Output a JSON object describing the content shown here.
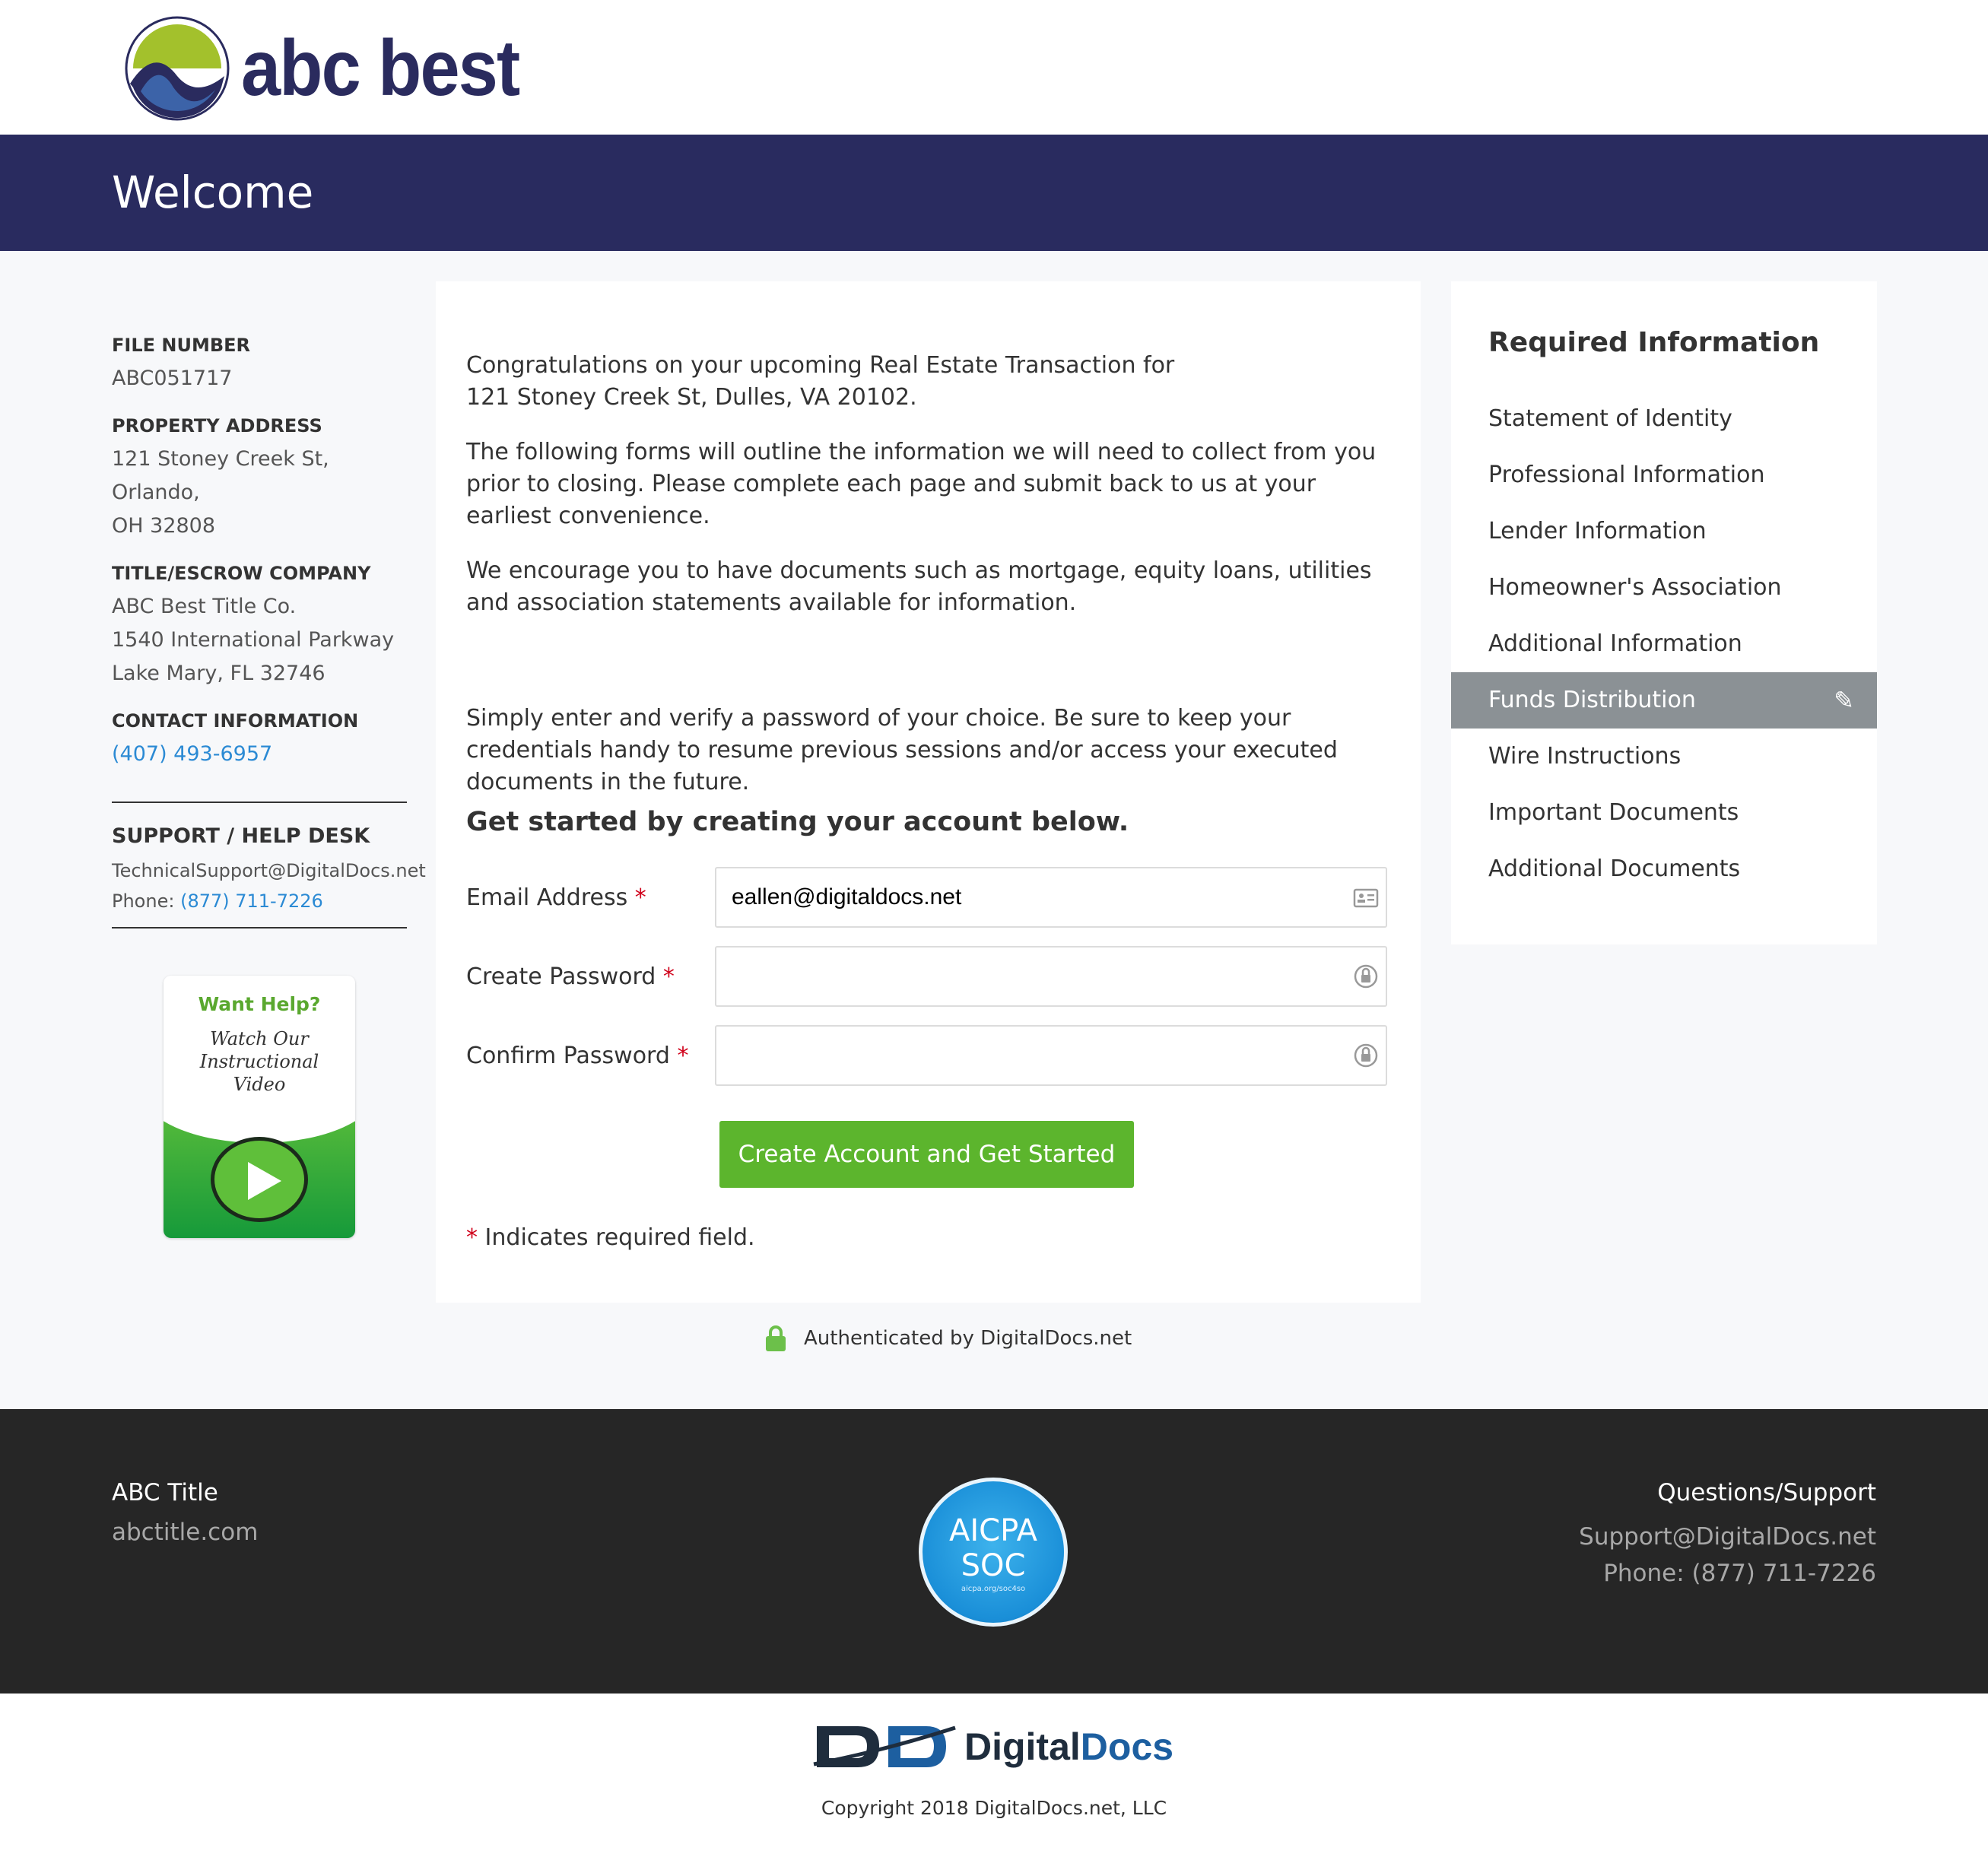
{
  "brand": {
    "logo_text": "abc best",
    "colors": {
      "navy": "#292b5f",
      "green": "#5cb52d",
      "link": "#2b8ad4"
    }
  },
  "header": {
    "title": "Welcome"
  },
  "left": {
    "file_number_label": "FILE NUMBER",
    "file_number": "ABC051717",
    "property_label": "PROPERTY ADDRESS",
    "property_line1": "121 Stoney Creek St, Orlando,",
    "property_line2": "OH 32808",
    "company_label": "TITLE/ESCROW COMPANY",
    "company_line1": "ABC Best Title Co.",
    "company_line2": "1540 International Parkway",
    "company_line3": "Lake Mary, FL 32746",
    "contact_label": "CONTACT INFORMATION",
    "contact_phone": "(407) 493-6957",
    "support_label": "SUPPORT / HELP DESK",
    "support_email": "TechnicalSupport@DigitalDocs.net",
    "support_phone_label": "Phone:",
    "support_phone": "(877) 711-7226",
    "help_title": "Want Help?",
    "help_line1": "Watch Our",
    "help_line2": "Instructional",
    "help_line3": "Video"
  },
  "main": {
    "intro_line1": "Congratulations on your upcoming Real Estate Transaction for",
    "intro_line2": "121 Stoney Creek St, Dulles, VA 20102.",
    "para2": "The following forms will outline the information we will need to collect from you prior to closing. Please complete each page and submit back to us at your earliest convenience.",
    "para3": "We encourage you to have documents such as mortgage, equity loans, utilities and association statements available for information.",
    "para4": "Simply enter and verify a password of your choice. Be sure to keep your credentials handy to resume previous sessions and/or access your executed documents in the future.",
    "heading": "Get started by creating your account below.",
    "email_label": "Email Address",
    "email_value": "eallen@digitaldocs.net",
    "password_label": "Create Password",
    "password_value": "",
    "confirm_label": "Confirm Password",
    "confirm_value": "",
    "required_mark": "*",
    "submit_label": "Create Account and Get Started",
    "required_note": "Indicates required field.",
    "auth_text": "Authenticated by DigitalDocs.net"
  },
  "right": {
    "title": "Required Information",
    "items": [
      {
        "label": "Statement of Identity",
        "active": false
      },
      {
        "label": "Professional Information",
        "active": false
      },
      {
        "label": "Lender Information",
        "active": false
      },
      {
        "label": "Homeowner's Association",
        "active": false
      },
      {
        "label": "Additional Information",
        "active": false
      },
      {
        "label": "Funds Distribution",
        "active": true,
        "icon": "pencil-icon"
      },
      {
        "label": "Wire Instructions",
        "active": false
      },
      {
        "label": "Important Documents",
        "active": false
      },
      {
        "label": "Additional Documents",
        "active": false
      }
    ]
  },
  "footer": {
    "left_title": "ABC Title",
    "left_link": "abctitle.com",
    "badge_line1": "AICPA",
    "badge_line2": "SOC",
    "badge_url": "aicpa.org/soc4so",
    "right_title": "Questions/Support",
    "right_email": "Support@DigitalDocs.net",
    "right_phone": "Phone: (877) 711-7226",
    "brand_digital": "Digital",
    "brand_docs": "Docs",
    "copyright": "Copyright 2018 DigitalDocs.net, LLC"
  }
}
